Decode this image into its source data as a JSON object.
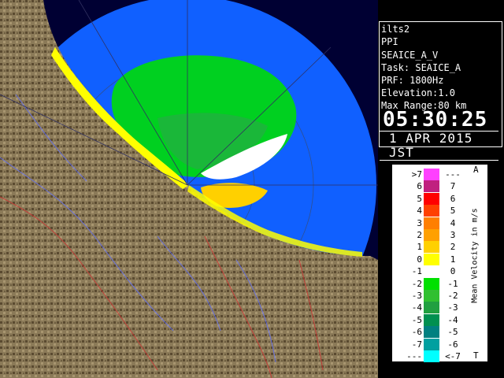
{
  "info": {
    "site": "ilts2",
    "product": "PPI",
    "task_short": "SEAICE_A_V",
    "task": "Task: SEAICE_A",
    "prf": "PRF: 1800Hz",
    "elevation": "Elevation:1.0",
    "max_range": "Max Range:80 km",
    "time": "05:30:25",
    "date": "1 APR 2015 JST"
  },
  "legend": {
    "title": "Mean Velocity in m/s",
    "top_marker": "A",
    "bottom_marker": "T",
    "rows": [
      {
        "left": ">7",
        "right": "---",
        "color": "#ff40ff"
      },
      {
        "left": "6",
        "right": "7",
        "color": "#c0207f"
      },
      {
        "left": "5",
        "right": "6",
        "color": "#ff0000"
      },
      {
        "left": "4",
        "right": "5",
        "color": "#ff4000"
      },
      {
        "left": "3",
        "right": "4",
        "color": "#ff7f00"
      },
      {
        "left": "2",
        "right": "3",
        "color": "#ffa000"
      },
      {
        "left": "1",
        "right": "2",
        "color": "#ffd000"
      },
      {
        "left": "0",
        "right": "1",
        "color": "#ffff00"
      },
      {
        "left": "-1",
        "right": "0",
        "color": "#ffffff"
      },
      {
        "left": "-2",
        "right": "-1",
        "color": "#00e000"
      },
      {
        "left": "-3",
        "right": "-2",
        "color": "#30c030"
      },
      {
        "left": "-4",
        "right": "-3",
        "color": "#20a040"
      },
      {
        "left": "-5",
        "right": "-4",
        "color": "#009050"
      },
      {
        "left": "-6",
        "right": "-5",
        "color": "#008080"
      },
      {
        "left": "-7",
        "right": "-6",
        "color": "#00a0a0"
      },
      {
        "left": "---",
        "right": "<-7",
        "color": "#00ffff"
      }
    ]
  },
  "colors": {
    "sea_range": "#1060ff",
    "outside": "#000033",
    "land": "#8b7a58",
    "coast_echo": "#ffff00",
    "echo_green": "#00d020"
  }
}
